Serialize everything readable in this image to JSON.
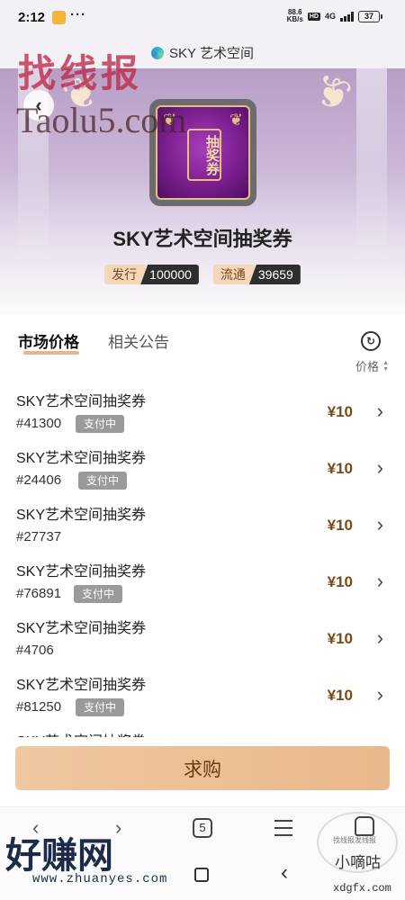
{
  "status_bar": {
    "time": "2:12",
    "menu_dots": "···",
    "net_speed_value": "88.6",
    "net_speed_unit": "KB/s",
    "hd": "HD",
    "network": "4G",
    "battery": "37"
  },
  "browser": {
    "page_title": "SKY 艺术空间",
    "tab_count": "5"
  },
  "hero": {
    "card_text": "抽奖券",
    "title": "SKY艺术空间抽奖券",
    "issued_label": "发行",
    "issued_value": "100000",
    "circulating_label": "流通",
    "circulating_value": "39659"
  },
  "tabs": {
    "market": "市场价格",
    "announcements": "相关公告"
  },
  "sort_label": "价格",
  "listings": [
    {
      "name": "SKY艺术空间抽奖券",
      "id": "#41300",
      "badge": "支付中",
      "price": "¥10"
    },
    {
      "name": "SKY艺术空间抽奖券",
      "id": "#24406",
      "badge": "支付中",
      "price": "¥10"
    },
    {
      "name": "SKY艺术空间抽奖券",
      "id": "#27737",
      "badge": "",
      "price": "¥10"
    },
    {
      "name": "SKY艺术空间抽奖券",
      "id": "#76891",
      "badge": "支付中",
      "price": "¥10"
    },
    {
      "name": "SKY艺术空间抽奖券",
      "id": "#4706",
      "badge": "",
      "price": "¥10"
    },
    {
      "name": "SKY艺术空间抽奖券",
      "id": "#81250",
      "badge": "支付中",
      "price": "¥10"
    },
    {
      "name": "SKY艺术空间抽奖券",
      "id": "",
      "badge": "",
      "price": ""
    }
  ],
  "buy_button": "求购",
  "watermarks": {
    "top_cn": "找线报",
    "top_en": "Taolu5.com",
    "bottom_cn": "好赚网",
    "bottom_url": "www.zhuanyes.com",
    "br_small": "找线报发线报",
    "br_name": "小嘀咕",
    "br_url": "xdgfx.com"
  },
  "colors": {
    "accent": "#e9b88b",
    "price": "#7a4a16",
    "badge": "#9a9a9a"
  }
}
